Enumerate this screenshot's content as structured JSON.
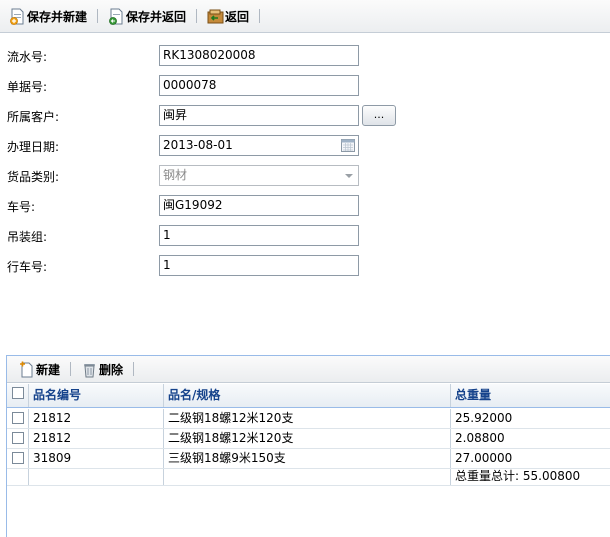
{
  "toolbar": {
    "save_new": "保存并新建",
    "save_return": "保存并返回",
    "back": "返回"
  },
  "form": {
    "serial": {
      "label": "流水号:",
      "value": "RK1308020008"
    },
    "doc_no": {
      "label": "单据号:",
      "value": "0000078"
    },
    "customer": {
      "label": "所属客户:",
      "value": "闽昇",
      "button": "..."
    },
    "date": {
      "label": "办理日期:",
      "value": "2013-08-01"
    },
    "category": {
      "label": "货品类别:",
      "value": "钢材"
    },
    "vehicle": {
      "label": "车号:",
      "value": "闽G19092"
    },
    "crane_group": {
      "label": "吊装组:",
      "value": "1"
    },
    "crane_no": {
      "label": "行车号:",
      "value": "1"
    }
  },
  "grid": {
    "toolbar": {
      "new": "新建",
      "delete": "删除"
    },
    "columns": [
      "品名编号",
      "品名/规格",
      "总重量"
    ],
    "rows": [
      {
        "code": "21812",
        "name": "二级钢18螺12米120支",
        "weight": "25.92000"
      },
      {
        "code": "21812",
        "name": "二级钢18螺12米120支",
        "weight": "2.08800"
      },
      {
        "code": "31809",
        "name": "三级钢18螺9米150支",
        "weight": "27.00000"
      }
    ],
    "summary": "总重量总计: 55.00800"
  }
}
